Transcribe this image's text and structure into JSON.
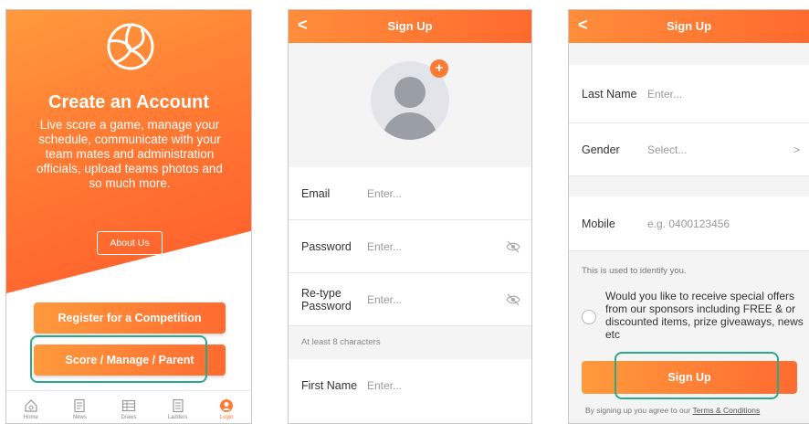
{
  "screen1": {
    "title": "Create an Account",
    "description": "Live score a game, manage your schedule, communicate with your team mates and administration officials, upload teams photos and so much more.",
    "about_button": "About Us",
    "register_button": "Register for a Competition",
    "score_button": "Score / Manage / Parent",
    "tabs": [
      {
        "label": "Home",
        "icon": "home-icon"
      },
      {
        "label": "News",
        "icon": "news-icon"
      },
      {
        "label": "Draws",
        "icon": "draws-icon"
      },
      {
        "label": "Ladders",
        "icon": "ladders-icon"
      },
      {
        "label": "Login",
        "icon": "user-icon"
      }
    ],
    "active_tab": "Login"
  },
  "screen2": {
    "back": "<",
    "title": "Sign Up",
    "fields": {
      "email": {
        "label": "Email",
        "placeholder": "Enter..."
      },
      "password": {
        "label": "Password",
        "placeholder": "Enter..."
      },
      "retype_label_line1": "Re-type",
      "retype_label_line2": "Password",
      "retype_placeholder": "Enter...",
      "hint": "At least 8 characters",
      "first_name": {
        "label": "First Name",
        "placeholder": "Enter..."
      }
    },
    "add_photo": "+"
  },
  "screen3": {
    "back": "<",
    "title": "Sign Up",
    "last_name": {
      "label": "Last Name",
      "placeholder": "Enter..."
    },
    "gender": {
      "label": "Gender",
      "placeholder": "Select...",
      "chevron": ">"
    },
    "mobile": {
      "label": "Mobile",
      "placeholder": "e.g. 0400123456"
    },
    "mobile_note": "This is used to identify you.",
    "offers_text": "Would you like to receive special offers from our sponsors including FREE & or discounted items, prize giveaways, news etc",
    "signup_button": "Sign Up",
    "terms_prefix": "By signing up you agree to our ",
    "terms_link": "Terms & Conditions"
  },
  "colors": {
    "accent": "#ff7a33",
    "highlight": "#2aa88a"
  }
}
